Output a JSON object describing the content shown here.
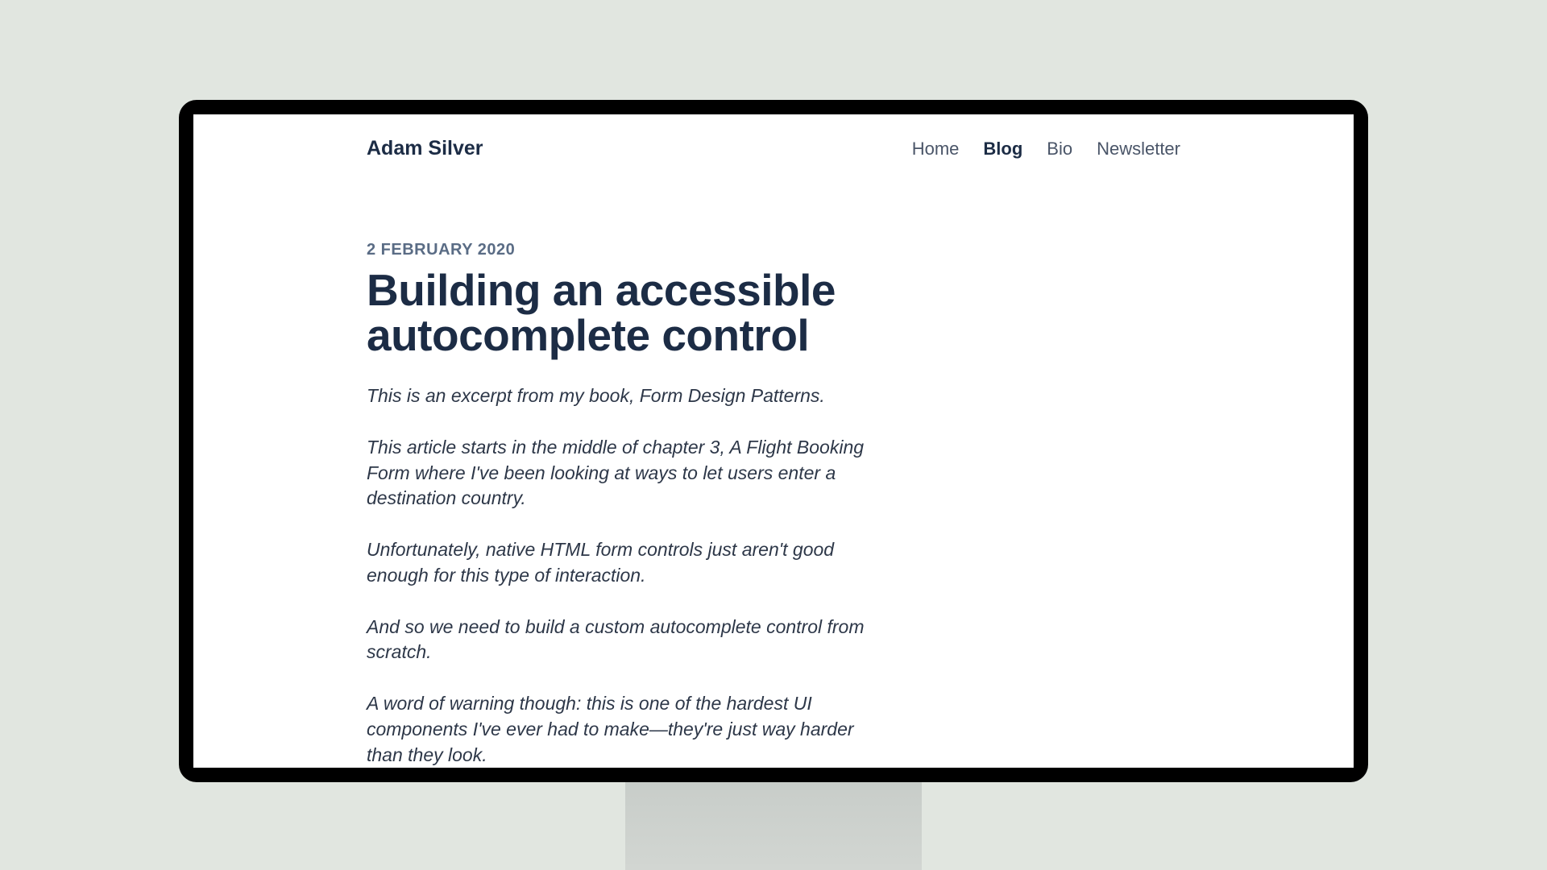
{
  "header": {
    "site_title": "Adam Silver",
    "nav": [
      {
        "label": "Home",
        "active": false
      },
      {
        "label": "Blog",
        "active": true
      },
      {
        "label": "Bio",
        "active": false
      },
      {
        "label": "Newsletter",
        "active": false
      }
    ]
  },
  "article": {
    "date": "2 FEBRUARY 2020",
    "title": "Building an accessible autocomplete control",
    "paragraphs": [
      "This is an excerpt from my book, Form Design Patterns.",
      "This article starts in the middle of chapter 3, A Flight Booking Form where I've been looking at ways to let users enter a destination country.",
      "Unfortunately, native HTML form controls just aren't good enough for this type of interaction.",
      "And so we need to build a custom autocomplete control from scratch.",
      "A word of warning though: this is one of the hardest UI components I've ever had to make—they're just way harder than they look."
    ]
  }
}
